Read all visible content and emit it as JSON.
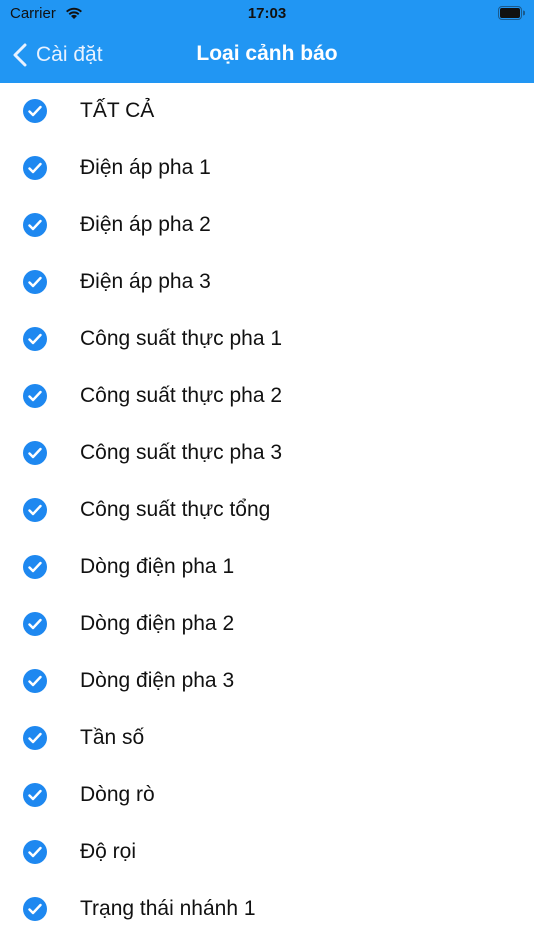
{
  "status_bar": {
    "carrier": "Carrier",
    "time": "17:03"
  },
  "nav": {
    "back_label": "Cài đặt",
    "title": "Loại cảnh báo"
  },
  "colors": {
    "header": "#2196f3",
    "check": "#1e88f0"
  },
  "items": [
    {
      "label": "TẤT CẢ",
      "checked": true
    },
    {
      "label": "Điện áp pha 1",
      "checked": true
    },
    {
      "label": "Điện áp pha 2",
      "checked": true
    },
    {
      "label": "Điện áp pha 3",
      "checked": true
    },
    {
      "label": "Công suất thực pha 1",
      "checked": true
    },
    {
      "label": "Công suất thực pha 2",
      "checked": true
    },
    {
      "label": "Công suất thực pha 3",
      "checked": true
    },
    {
      "label": "Công suất thực tổng",
      "checked": true
    },
    {
      "label": "Dòng điện pha 1",
      "checked": true
    },
    {
      "label": "Dòng điện pha 2",
      "checked": true
    },
    {
      "label": "Dòng điện pha 3",
      "checked": true
    },
    {
      "label": "Tần số",
      "checked": true
    },
    {
      "label": "Dòng rò",
      "checked": true
    },
    {
      "label": "Độ rọi",
      "checked": true
    },
    {
      "label": "Trạng thái nhánh 1",
      "checked": true
    }
  ]
}
